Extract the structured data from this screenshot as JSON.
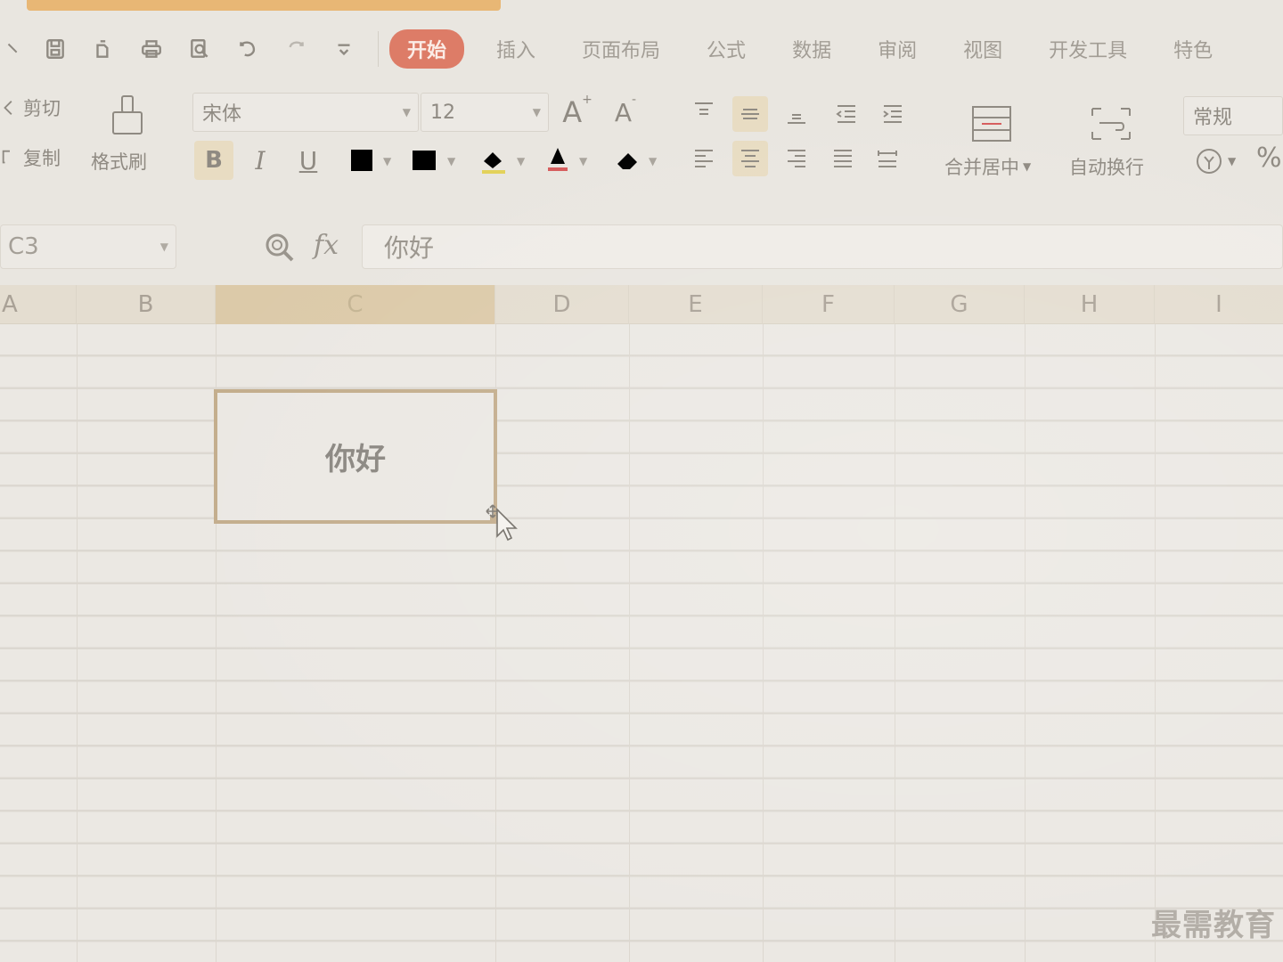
{
  "tabs": [
    {
      "label": "开始",
      "active": true
    },
    {
      "label": "插入"
    },
    {
      "label": "页面布局"
    },
    {
      "label": "公式"
    },
    {
      "label": "数据"
    },
    {
      "label": "审阅"
    },
    {
      "label": "视图"
    },
    {
      "label": "开发工具"
    },
    {
      "label": "特色"
    }
  ],
  "quick_access_icons": [
    "save-icon",
    "print-preview-icon",
    "print-icon",
    "preview-icon",
    "undo-icon",
    "redo-icon",
    "customize-icon"
  ],
  "ribbon": {
    "cut": "剪切",
    "copy": "复制",
    "format_painter": "格式刷",
    "font_name": "宋体",
    "font_size": "12",
    "bold": "B",
    "italic": "I",
    "underline": "U",
    "increase_font": "A",
    "decrease_font": "A",
    "merge_center": "合并居中",
    "wrap_text": "自动换行",
    "number_format": "常规",
    "percent": "%"
  },
  "formula_bar": {
    "name_box": "C3",
    "fx": "fx",
    "content": "你好"
  },
  "columns": [
    "A",
    "B",
    "C",
    "D",
    "E",
    "F",
    "G",
    "H",
    "I"
  ],
  "selected_column": "C",
  "active_cell": {
    "ref": "C3",
    "value": "你好"
  },
  "watermark": "最需教育",
  "colors": {
    "accent_tab": "#dd7c67",
    "top_strip": "#e7ae62",
    "selection_border": "#c3ad8c"
  }
}
